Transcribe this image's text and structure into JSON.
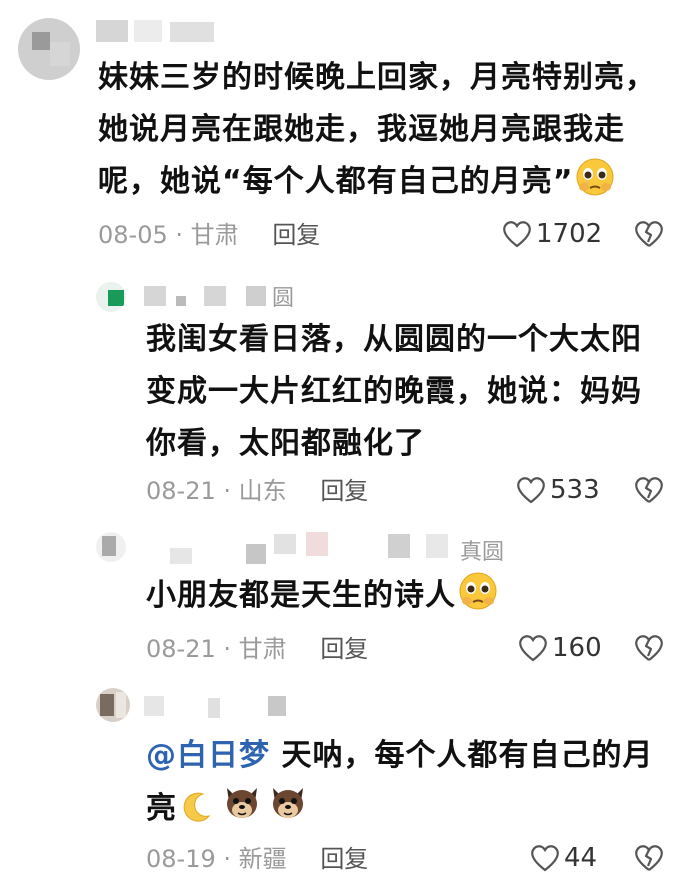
{
  "comments": [
    {
      "text": "妹妹三岁的时候晚上回家，月亮特别亮，她说月亮在跟她走，我逗她月亮跟我走呢，她说“每个人都有自己的月亮”",
      "line1": "妹妹三岁的时候晚上回家，月亮特别亮，",
      "line2": "她说月亮在跟她走，我逗她月亮跟我走",
      "line3": "呢，她说“每个人都有自己的月亮”",
      "date": "08-05",
      "location": "甘肃",
      "reply": "回复",
      "likes": "1702",
      "emoji": "pleading-face-icon"
    },
    {
      "name_tail": "圆",
      "line1": "我闺女看日落，从圆圆的一个大太阳",
      "line2": "变成一大片红红的晚霞，她说：妈妈",
      "line3": "你看，太阳都融化了",
      "date": "08-21",
      "location": "山东",
      "reply": "回复",
      "likes": "533"
    },
    {
      "name_tail": "真圆",
      "line1": "小朋友都是天生的诗人",
      "date": "08-21",
      "location": "甘肃",
      "reply": "回复",
      "likes": "160",
      "emoji": "pleading-face-icon"
    },
    {
      "mention": "@白日梦",
      "line1": "天呐，每个人都有自己的月",
      "line2": "亮",
      "date": "08-19",
      "location": "新疆",
      "reply": "回复",
      "likes": "44",
      "emojis": [
        "crescent-moon-icon",
        "dog-face-icon",
        "dog-face-icon"
      ]
    }
  ],
  "separator": "·"
}
